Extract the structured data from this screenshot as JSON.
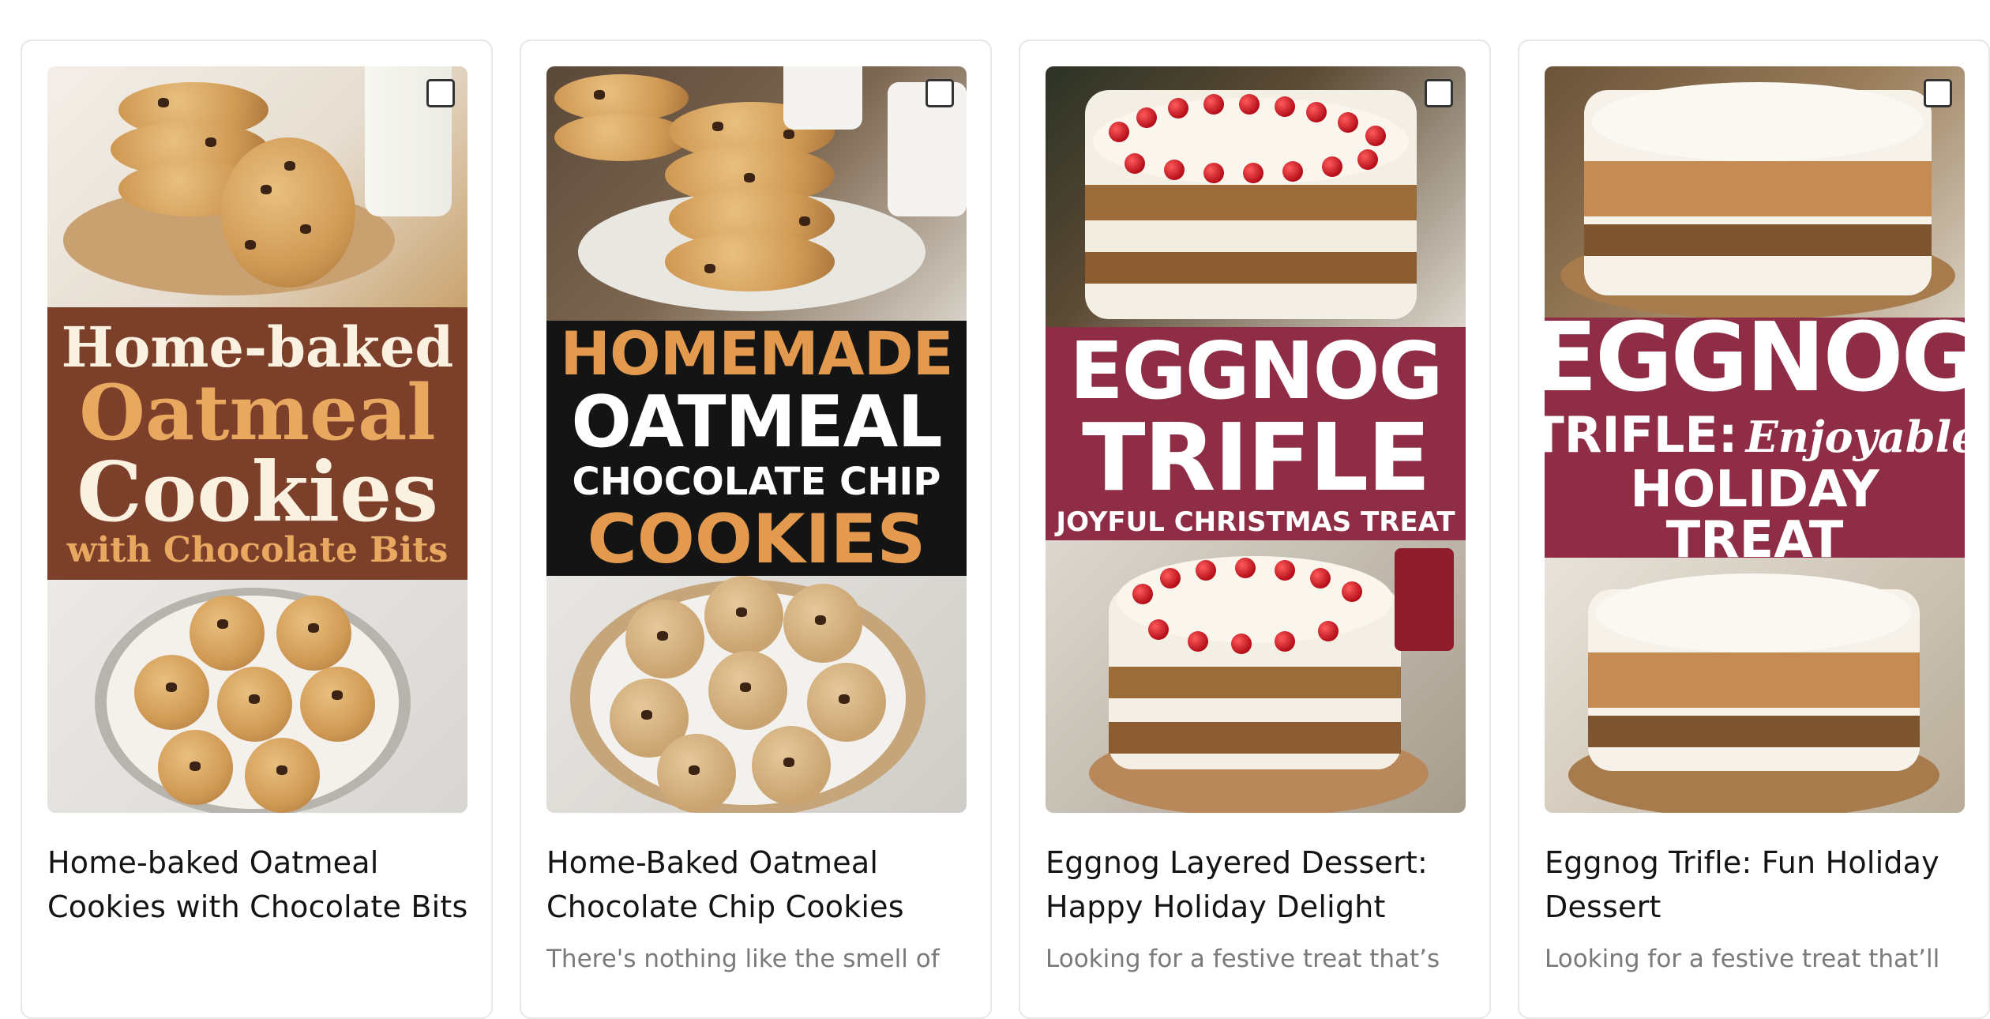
{
  "cards": [
    {
      "banner": [
        "Home-baked",
        "Oatmeal",
        "Cookies",
        "with Chocolate Bits"
      ],
      "title": "Home-baked Oatmeal Cookies with Chocolate Bits",
      "description": ""
    },
    {
      "banner": [
        "HOMEMADE",
        "OATMEAL",
        "CHOCOLATE CHIP",
        "COOKIES"
      ],
      "title": "Home-Baked Oatmeal Chocolate Chip Cookies",
      "description": "There's nothing like the smell of"
    },
    {
      "banner": [
        "EGGNOG",
        "TRIFLE",
        "JOYFUL CHRISTMAS TREAT"
      ],
      "title": "Eggnog Layered Dessert: Happy Holiday Delight",
      "description": "Looking for a festive treat that’s"
    },
    {
      "banner": [
        "EGGNOG",
        "TRIFLE:",
        "Enjoyable",
        "HOLIDAY TREAT"
      ],
      "title": "Eggnog Trifle: Fun Holiday Dessert",
      "description": "Looking for a festive treat that’ll"
    }
  ],
  "colors": {
    "card_border": "#e7e7e7",
    "title_text": "#141414",
    "desc_text": "#7a7a7a",
    "banner_brown": "#7b3f2a",
    "banner_black": "#141414",
    "banner_maroon": "#8e2d45",
    "cookie_gold": "#e39a4f"
  }
}
